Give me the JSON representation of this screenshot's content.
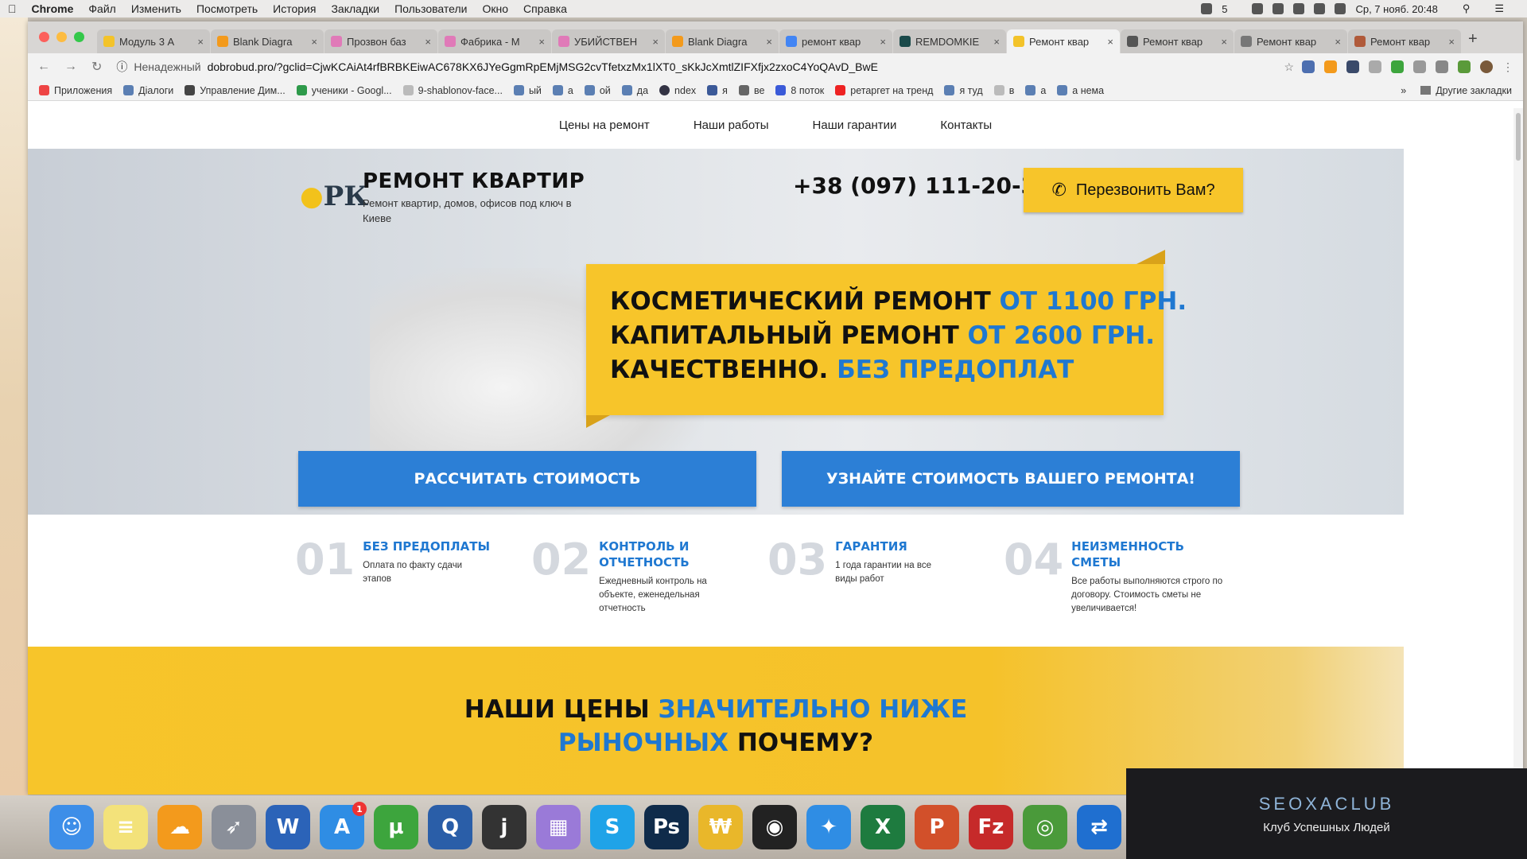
{
  "mac_menu": {
    "app": "Chrome",
    "items": [
      "Файл",
      "Изменить",
      "Посмотреть",
      "История",
      "Закладки",
      "Пользователи",
      "Окно",
      "Справка"
    ],
    "battery": "5",
    "datetime": "Ср, 7 нояб. 20:48"
  },
  "tabs": [
    {
      "label": "Модуль 3 А",
      "active": false
    },
    {
      "label": "Blank Diagra",
      "active": false
    },
    {
      "label": "Прозвон баз",
      "active": false
    },
    {
      "label": "Фабрика - М",
      "active": false
    },
    {
      "label": "УБИЙСТВЕН",
      "active": false
    },
    {
      "label": "Blank Diagra",
      "active": false
    },
    {
      "label": "ремонт квар",
      "active": false
    },
    {
      "label": "REMDOMKIE",
      "active": false
    },
    {
      "label": "Ремонт квар",
      "active": true
    },
    {
      "label": "Ремонт квар",
      "active": false
    },
    {
      "label": "Ремонт квар",
      "active": false
    },
    {
      "label": "Ремонт квар",
      "active": false
    }
  ],
  "address": {
    "security": "Ненадежный",
    "url": "dobrobud.pro/?gclid=CjwKCAiAt4rfBRBKEiwAC678KX6JYeGgmRpEMjMSG2cvTfetxzMx1lXT0_sKkJcXmtlZIFXfjx2zxoC4YoQAvD_BwE"
  },
  "bookmarks": [
    "Приложения",
    "Діалоги",
    "Управление Дим...",
    "ученики - Googl...",
    "9-shablonov-face...",
    "ый",
    "а",
    "ой",
    "да",
    "ndex",
    "я",
    "ве",
    "8 поток",
    "ретаргет на тренд",
    "я туд",
    "в",
    "а",
    "а нема"
  ],
  "bookmarks_other": "Другие закладки",
  "site": {
    "nav": [
      "Цены на ремонт",
      "Наши работы",
      "Наши гарантии",
      "Контакты"
    ],
    "logo": "РК",
    "brand_title": "РЕМОНТ КВАРТИР",
    "brand_subtitle": "Ремонт квартир, домов, офисов под ключ в Киеве",
    "phone": "+38 (097) 111-20-30",
    "callback": "Перезвонить Вам?",
    "promo": [
      {
        "text": "КОСМЕТИЧЕСКИЙ РЕМОНТ ",
        "accent": "ОТ 1100 ГРН."
      },
      {
        "text": "КАПИТАЛЬНЫЙ РЕМОНТ ",
        "accent": "ОТ 2600 ГРН."
      },
      {
        "text": "КАЧЕСТВЕННО. ",
        "accent": "БЕЗ ПРЕДОПЛАТ"
      }
    ],
    "cta_left": "РАССЧИТАТЬ СТОИМОСТЬ",
    "cta_right": "УЗНАЙТЕ СТОИМОСТЬ ВАШЕГО РЕМОНТА!",
    "features": [
      {
        "num": "01",
        "title": "БЕЗ ПРЕДОПЛАТЫ",
        "desc": "Оплата по факту сдачи этапов"
      },
      {
        "num": "02",
        "title": "КОНТРОЛЬ И ОТЧЕТНОСТЬ",
        "desc": "Ежедневный контроль на объекте, еженедельная отчетность"
      },
      {
        "num": "03",
        "title": "ГАРАНТИЯ",
        "desc": "1 года гарантии на все виды работ"
      },
      {
        "num": "04",
        "title": "НЕИЗМЕННОСТЬ СМЕТЫ",
        "desc": "Все работы выполняются строго по договору. Стоимость сметы не увеличивается!"
      }
    ],
    "prices_heading": {
      "part1": "НАШИ ЦЕНЫ ",
      "accent1": "ЗНАЧИТЕЛЬНО НИЖЕ",
      "accent2": "РЫНОЧНЫХ",
      "part2": " ПОЧЕМУ?"
    }
  },
  "dock": [
    {
      "name": "finder",
      "glyph": "☺",
      "color": "#3d8ee8"
    },
    {
      "name": "notes",
      "glyph": "≡",
      "color": "#f3e27a"
    },
    {
      "name": "cloud",
      "glyph": "☁",
      "color": "#f39a1c"
    },
    {
      "name": "launchpad",
      "glyph": "➶",
      "color": "#8a8f99"
    },
    {
      "name": "word",
      "glyph": "W",
      "color": "#2b63b8"
    },
    {
      "name": "appstore",
      "glyph": "A",
      "color": "#2f8de4",
      "badge": "1"
    },
    {
      "name": "utorrent",
      "glyph": "µ",
      "color": "#3da53d"
    },
    {
      "name": "quicktime",
      "glyph": "Q",
      "color": "#2a5ea8"
    },
    {
      "name": "jing",
      "glyph": "j",
      "color": "#333"
    },
    {
      "name": "calendar",
      "glyph": "▦",
      "color": "#9a7ad8"
    },
    {
      "name": "skype",
      "glyph": "S",
      "color": "#1fa3e8"
    },
    {
      "name": "photoshop",
      "glyph": "Ps",
      "color": "#0f2b4a"
    },
    {
      "name": "vlc",
      "glyph": "₩",
      "color": "#e9b72a"
    },
    {
      "name": "camera",
      "glyph": "◉",
      "color": "#222"
    },
    {
      "name": "safari",
      "glyph": "✦",
      "color": "#2f8de4"
    },
    {
      "name": "excel",
      "glyph": "X",
      "color": "#1e7b3f"
    },
    {
      "name": "powerpoint",
      "glyph": "P",
      "color": "#d2502a"
    },
    {
      "name": "filezilla",
      "glyph": "Fz",
      "color": "#c62a2a"
    },
    {
      "name": "chrome",
      "glyph": "◎",
      "color": "#4a9a3a"
    },
    {
      "name": "teamviewer",
      "glyph": "⇄",
      "color": "#1f6fd0"
    }
  ],
  "watermark": {
    "title": "SEOXACLUB",
    "subtitle": "Клуб Успешных Людей"
  }
}
